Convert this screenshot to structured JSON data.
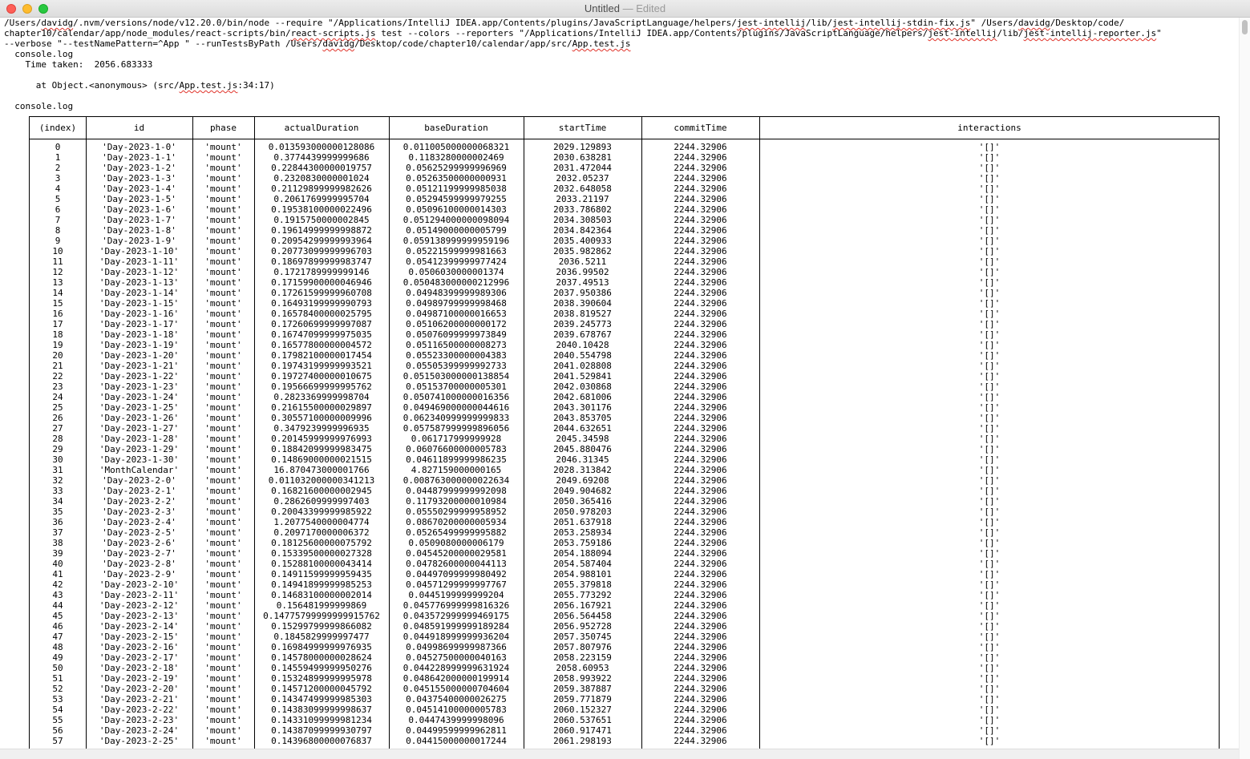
{
  "window": {
    "title": "Untitled",
    "edited_suffix": "— Edited"
  },
  "lines": [
    {
      "segments": [
        "/Users/",
        "*davidg",
        "/.nvm/versions/node/v12.20.0/bin/node --require \"/Applications/IntelliJ IDEA.app/Contents/plugins/JavaScriptLanguage/helpers/",
        "*jest-intellij",
        "/lib/",
        "*jest-intellij-stdin-fix.js",
        "\" /Users/",
        "*davidg",
        "/Desktop/code/"
      ]
    },
    {
      "segments": [
        "chapter10/calendar/app/node_modules/react-scripts/bin/",
        "*react-scripts.js",
        " test --colors --reporters \"/Applications/IntelliJ IDEA.app/Contents/plugins/JavaScriptLanguage/helpers/",
        "*jest-intellij",
        "/lib/",
        "*jest-intellij-reporter.js",
        "\""
      ]
    },
    {
      "segments": [
        "--verbose \"--testNamePattern=^App \" --runTestsByPath /Users/",
        "*davidg",
        "/Desktop/code/chapter10/calendar/app/src/",
        "*App.test.js"
      ]
    },
    {
      "segments": [
        "  console.log"
      ]
    },
    {
      "segments": [
        "    Time taken:  2056.683333"
      ]
    },
    {
      "segments": [
        ""
      ]
    },
    {
      "segments": [
        "      at Object.<anonymous> (src/",
        "*App.test.js",
        ":34:17)"
      ]
    },
    {
      "segments": [
        ""
      ]
    },
    {
      "segments": [
        "  console.log"
      ]
    }
  ],
  "table": {
    "headers": [
      "(index)",
      "id",
      "phase",
      "actualDuration",
      "baseDuration",
      "startTime",
      "commitTime",
      "interactions"
    ],
    "rows": [
      [
        "0",
        "'Day-2023-1-0'",
        "'mount'",
        "0.013593000000128086",
        "0.011005000000068321",
        "2029.129893",
        "2244.32906",
        "'[]'"
      ],
      [
        "1",
        "'Day-2023-1-1'",
        "'mount'",
        "0.3774439999999686",
        "0.1183280000002469",
        "2030.638281",
        "2244.32906",
        "'[]'"
      ],
      [
        "2",
        "'Day-2023-1-2'",
        "'mount'",
        "0.22844300000019757",
        "0.05625299999996969",
        "2031.472044",
        "2244.32906",
        "'[]'"
      ],
      [
        "3",
        "'Day-2023-1-3'",
        "'mount'",
        "0.2320830000001024",
        "0.05263500000000931",
        "2032.05237",
        "2244.32906",
        "'[]'"
      ],
      [
        "4",
        "'Day-2023-1-4'",
        "'mount'",
        "0.21129899999982626",
        "0.05121199999985038",
        "2032.648058",
        "2244.32906",
        "'[]'"
      ],
      [
        "5",
        "'Day-2023-1-5'",
        "'mount'",
        "0.2061769999995704",
        "0.05294599999979255",
        "2033.21197",
        "2244.32906",
        "'[]'"
      ],
      [
        "6",
        "'Day-2023-1-6'",
        "'mount'",
        "0.19538100000022496",
        "0.05096100000014303",
        "2033.786802",
        "2244.32906",
        "'[]'"
      ],
      [
        "7",
        "'Day-2023-1-7'",
        "'mount'",
        "0.1915750000002845",
        "0.051294000000098094",
        "2034.308503",
        "2244.32906",
        "'[]'"
      ],
      [
        "8",
        "'Day-2023-1-8'",
        "'mount'",
        "0.19614999999998872",
        "0.05149000000005799",
        "2034.842364",
        "2244.32906",
        "'[]'"
      ],
      [
        "9",
        "'Day-2023-1-9'",
        "'mount'",
        "0.20954299999993964",
        "0.059138999999959196",
        "2035.400933",
        "2244.32906",
        "'[]'"
      ],
      [
        "10",
        "'Day-2023-1-10'",
        "'mount'",
        "0.20773099999996703",
        "0.05221599999981663",
        "2035.982862",
        "2244.32906",
        "'[]'"
      ],
      [
        "11",
        "'Day-2023-1-11'",
        "'mount'",
        "0.18697899999983747",
        "0.05412399999977424",
        "2036.5211",
        "2244.32906",
        "'[]'"
      ],
      [
        "12",
        "'Day-2023-1-12'",
        "'mount'",
        "0.1721789999999146",
        "0.0506030000001374",
        "2036.99502",
        "2244.32906",
        "'[]'"
      ],
      [
        "13",
        "'Day-2023-1-13'",
        "'mount'",
        "0.17159900000046946",
        "0.050483000000212996",
        "2037.49513",
        "2244.32906",
        "'[]'"
      ],
      [
        "14",
        "'Day-2023-1-14'",
        "'mount'",
        "0.17261599999960708",
        "0.04948399999989306",
        "2037.950386",
        "2244.32906",
        "'[]'"
      ],
      [
        "15",
        "'Day-2023-1-15'",
        "'mount'",
        "0.16493199999990793",
        "0.04989799999998468",
        "2038.390604",
        "2244.32906",
        "'[]'"
      ],
      [
        "16",
        "'Day-2023-1-16'",
        "'mount'",
        "0.16578400000025795",
        "0.04987100000016653",
        "2038.819527",
        "2244.32906",
        "'[]'"
      ],
      [
        "17",
        "'Day-2023-1-17'",
        "'mount'",
        "0.17260699999997087",
        "0.05106200000000172",
        "2039.245773",
        "2244.32906",
        "'[]'"
      ],
      [
        "18",
        "'Day-2023-1-18'",
        "'mount'",
        "0.16747099999975035",
        "0.05076099999973849",
        "2039.678767",
        "2244.32906",
        "'[]'"
      ],
      [
        "19",
        "'Day-2023-1-19'",
        "'mount'",
        "0.16577800000004572",
        "0.05116500000008273",
        "2040.10428",
        "2244.32906",
        "'[]'"
      ],
      [
        "20",
        "'Day-2023-1-20'",
        "'mount'",
        "0.17982100000017454",
        "0.05523300000004383",
        "2040.554798",
        "2244.32906",
        "'[]'"
      ],
      [
        "21",
        "'Day-2023-1-21'",
        "'mount'",
        "0.19743199999993521",
        "0.05505399999992733",
        "2041.028808",
        "2244.32906",
        "'[]'"
      ],
      [
        "22",
        "'Day-2023-1-22'",
        "'mount'",
        "0.19727400000010675",
        "0.051503000000138854",
        "2041.529841",
        "2244.32906",
        "'[]'"
      ],
      [
        "23",
        "'Day-2023-1-23'",
        "'mount'",
        "0.19566699999995762",
        "0.05153700000005301",
        "2042.030868",
        "2244.32906",
        "'[]'"
      ],
      [
        "24",
        "'Day-2023-1-24'",
        "'mount'",
        "0.2823369999998704",
        "0.050741000000016356",
        "2042.681006",
        "2244.32906",
        "'[]'"
      ],
      [
        "25",
        "'Day-2023-1-25'",
        "'mount'",
        "0.21615500000029897",
        "0.049469000000044616",
        "2043.301176",
        "2244.32906",
        "'[]'"
      ],
      [
        "26",
        "'Day-2023-1-26'",
        "'mount'",
        "0.30557100000009996",
        "0.062340999999999833",
        "2043.853705",
        "2244.32906",
        "'[]'"
      ],
      [
        "27",
        "'Day-2023-1-27'",
        "'mount'",
        "0.3479239999996935",
        "0.057587999999896056",
        "2044.632651",
        "2244.32906",
        "'[]'"
      ],
      [
        "28",
        "'Day-2023-1-28'",
        "'mount'",
        "0.20145999999976993",
        "0.061717999999928",
        "2045.34598",
        "2244.32906",
        "'[]'"
      ],
      [
        "29",
        "'Day-2023-1-29'",
        "'mount'",
        "0.18842099999983475",
        "0.06076600000005783",
        "2045.880476",
        "2244.32906",
        "'[]'"
      ],
      [
        "30",
        "'Day-2023-1-30'",
        "'mount'",
        "0.14869000000021515",
        "0.04611899999986235",
        "2046.31345",
        "2244.32906",
        "'[]'"
      ],
      [
        "31",
        "'MonthCalendar'",
        "'mount'",
        "16.870473000001766",
        "4.827159000000165",
        "2028.313842",
        "2244.32906",
        "'[]'"
      ],
      [
        "32",
        "'Day-2023-2-0'",
        "'mount'",
        "0.011032000000341213",
        "0.008763000000022634",
        "2049.69208",
        "2244.32906",
        "'[]'"
      ],
      [
        "33",
        "'Day-2023-2-1'",
        "'mount'",
        "0.16821600000002945",
        "0.04487999999992098",
        "2049.904682",
        "2244.32906",
        "'[]'"
      ],
      [
        "34",
        "'Day-2023-2-2'",
        "'mount'",
        "0.2862609999997403",
        "0.11793200000010984",
        "2050.365416",
        "2244.32906",
        "'[]'"
      ],
      [
        "35",
        "'Day-2023-2-3'",
        "'mount'",
        "0.20043399999985922",
        "0.05550299999958952",
        "2050.978203",
        "2244.32906",
        "'[]'"
      ],
      [
        "36",
        "'Day-2023-2-4'",
        "'mount'",
        "1.2077540000004774",
        "0.08670200000005934",
        "2051.637918",
        "2244.32906",
        "'[]'"
      ],
      [
        "37",
        "'Day-2023-2-5'",
        "'mount'",
        "0.2097170000006372",
        "0.05265499999995882",
        "2053.258934",
        "2244.32906",
        "'[]'"
      ],
      [
        "38",
        "'Day-2023-2-6'",
        "'mount'",
        "0.18125600000075792",
        "0.0509080000006179",
        "2053.759186",
        "2244.32906",
        "'[]'"
      ],
      [
        "39",
        "'Day-2023-2-7'",
        "'mount'",
        "0.15339500000027328",
        "0.04545200000029581",
        "2054.188094",
        "2244.32906",
        "'[]'"
      ],
      [
        "40",
        "'Day-2023-2-8'",
        "'mount'",
        "0.15288100000043414",
        "0.04782600000044113",
        "2054.587404",
        "2244.32906",
        "'[]'"
      ],
      [
        "41",
        "'Day-2023-2-9'",
        "'mount'",
        "0.14911599999959435",
        "0.04497099999980492",
        "2054.988101",
        "2244.32906",
        "'[]'"
      ],
      [
        "42",
        "'Day-2023-2-10'",
        "'mount'",
        "0.14941899999985253",
        "0.04571299999997767",
        "2055.379818",
        "2244.32906",
        "'[]'"
      ],
      [
        "43",
        "'Day-2023-2-11'",
        "'mount'",
        "0.14683100000002014",
        "0.0445199999999204",
        "2055.773292",
        "2244.32906",
        "'[]'"
      ],
      [
        "44",
        "'Day-2023-2-12'",
        "'mount'",
        "0.156481999999869",
        "0.045776999999816326",
        "2056.167921",
        "2244.32906",
        "'[]'"
      ],
      [
        "45",
        "'Day-2023-2-13'",
        "'mount'",
        "0.14775799999999915762",
        "0.043572999999469175",
        "2056.564458",
        "2244.32906",
        "'[]'"
      ],
      [
        "46",
        "'Day-2023-2-14'",
        "'mount'",
        "0.15299799999866082",
        "0.048591999999189284",
        "2056.952728",
        "2244.32906",
        "'[]'"
      ],
      [
        "47",
        "'Day-2023-2-15'",
        "'mount'",
        "0.1845829999997477",
        "0.044918999999936204",
        "2057.350745",
        "2244.32906",
        "'[]'"
      ],
      [
        "48",
        "'Day-2023-2-16'",
        "'mount'",
        "0.16984999999976935",
        "0.04998699999987366",
        "2057.807976",
        "2244.32906",
        "'[]'"
      ],
      [
        "49",
        "'Day-2023-2-17'",
        "'mount'",
        "0.14578000000028624",
        "0.04527500000040163",
        "2058.223159",
        "2244.32906",
        "'[]'"
      ],
      [
        "50",
        "'Day-2023-2-18'",
        "'mount'",
        "0.14559499999950276",
        "0.044228999999631924",
        "2058.60953",
        "2244.32906",
        "'[]'"
      ],
      [
        "51",
        "'Day-2023-2-19'",
        "'mount'",
        "0.15324899999995978",
        "0.048642000000199914",
        "2058.993922",
        "2244.32906",
        "'[]'"
      ],
      [
        "52",
        "'Day-2023-2-20'",
        "'mount'",
        "0.14571200000045792",
        "0.045155000000704604",
        "2059.387887",
        "2244.32906",
        "'[]'"
      ],
      [
        "53",
        "'Day-2023-2-21'",
        "'mount'",
        "0.14347499999985303",
        "0.04375400000026275",
        "2059.771879",
        "2244.32906",
        "'[]'"
      ],
      [
        "54",
        "'Day-2023-2-22'",
        "'mount'",
        "0.14383099999998637",
        "0.04514100000005783",
        "2060.152327",
        "2244.32906",
        "'[]'"
      ],
      [
        "55",
        "'Day-2023-2-23'",
        "'mount'",
        "0.14331099999981234",
        "0.0447439999998096",
        "2060.537651",
        "2244.32906",
        "'[]'"
      ],
      [
        "56",
        "'Day-2023-2-24'",
        "'mount'",
        "0.14387099999930797",
        "0.04499599999962811",
        "2060.917471",
        "2244.32906",
        "'[]'"
      ],
      [
        "57",
        "'Day-2023-2-25'",
        "'mount'",
        "0.14396800000076837",
        "0.04415000000017244",
        "2061.298193",
        "2244.32906",
        "'[]'"
      ]
    ]
  }
}
